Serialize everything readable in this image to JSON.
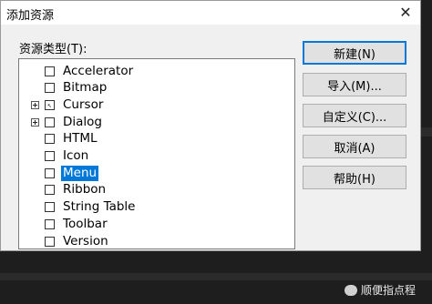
{
  "dialog": {
    "title": "添加资源",
    "close_glyph": "✕",
    "type_label": "资源类型(T):",
    "tree_items": [
      {
        "label": "Accelerator",
        "icon": "accelerator-icon",
        "glyph": "",
        "expander": false,
        "selected": false
      },
      {
        "label": "Bitmap",
        "icon": "bitmap-icon",
        "glyph": "",
        "expander": false,
        "selected": false
      },
      {
        "label": "Cursor",
        "icon": "cursor-icon",
        "glyph": "↖",
        "expander": true,
        "selected": false
      },
      {
        "label": "Dialog",
        "icon": "dialog-icon",
        "glyph": "",
        "expander": true,
        "selected": false
      },
      {
        "label": "HTML",
        "icon": "html-icon",
        "glyph": "",
        "expander": false,
        "selected": false
      },
      {
        "label": "Icon",
        "icon": "icon-file-icon",
        "glyph": "",
        "expander": false,
        "selected": false
      },
      {
        "label": "Menu",
        "icon": "menu-icon",
        "glyph": "",
        "expander": false,
        "selected": true
      },
      {
        "label": "Ribbon",
        "icon": "ribbon-icon",
        "glyph": "",
        "expander": false,
        "selected": false
      },
      {
        "label": "String Table",
        "icon": "string-table-icon",
        "glyph": "",
        "expander": false,
        "selected": false
      },
      {
        "label": "Toolbar",
        "icon": "toolbar-icon",
        "glyph": "",
        "expander": false,
        "selected": false
      },
      {
        "label": "Version",
        "icon": "version-icon",
        "glyph": "",
        "expander": false,
        "selected": false
      }
    ],
    "buttons": {
      "new": "新建(N)",
      "import": "导入(M)...",
      "custom": "自定义(C)...",
      "cancel": "取消(A)",
      "help": "帮助(H)"
    }
  },
  "watermark": "顺便指点程",
  "colors": {
    "selection": "#0078d7",
    "dialog_bg": "#f0f0f0"
  }
}
